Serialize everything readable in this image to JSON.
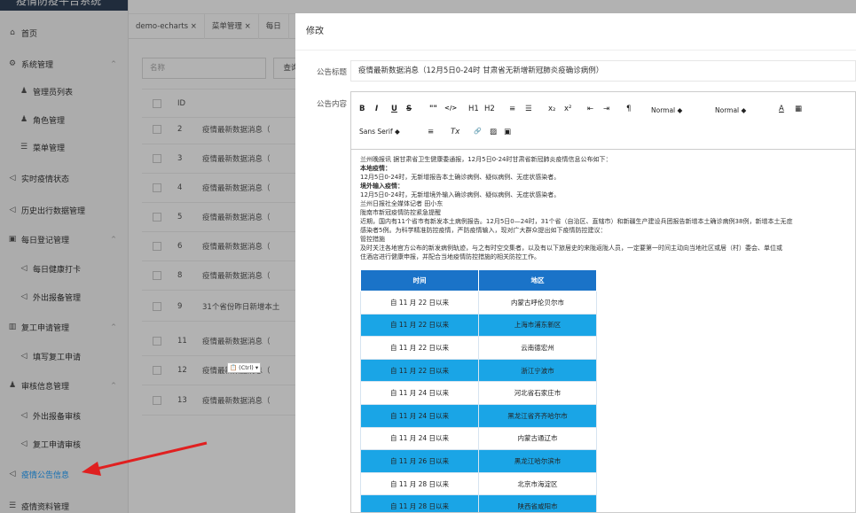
{
  "sidebar": {
    "brand": "疫情防疫平台系统",
    "items": [
      {
        "label": "首页",
        "icon": "home-icon",
        "glyph": "⌂",
        "level": 1
      },
      {
        "label": "系统管理",
        "icon": "gear-icon",
        "glyph": "⚙",
        "level": 1,
        "expand": true
      },
      {
        "label": "管理员列表",
        "icon": "user-icon",
        "glyph": "♟",
        "level": 2
      },
      {
        "label": "角色管理",
        "icon": "user-icon",
        "glyph": "♟",
        "level": 2
      },
      {
        "label": "菜单管理",
        "icon": "list-icon",
        "glyph": "☰",
        "level": 2
      },
      {
        "label": "实时疫情状态",
        "icon": "send-icon",
        "glyph": "◁",
        "level": 1
      },
      {
        "label": "历史出行数据管理",
        "icon": "send-icon",
        "glyph": "◁",
        "level": 1
      },
      {
        "label": "每日登记管理",
        "icon": "form-icon",
        "glyph": "▣",
        "level": 1,
        "expand": true
      },
      {
        "label": "每日健康打卡",
        "icon": "send-icon",
        "glyph": "◁",
        "level": 2
      },
      {
        "label": "外出报备管理",
        "icon": "send-icon",
        "glyph": "◁",
        "level": 2
      },
      {
        "label": "复工申请管理",
        "icon": "chart-icon",
        "glyph": "▥",
        "level": 1,
        "expand": true
      },
      {
        "label": "填写复工申请",
        "icon": "send-icon",
        "glyph": "◁",
        "level": 2
      },
      {
        "label": "审核信息管理",
        "icon": "user-icon",
        "glyph": "♟",
        "level": 1,
        "expand": true
      },
      {
        "label": "外出报备审核",
        "icon": "send-icon",
        "glyph": "◁",
        "level": 2
      },
      {
        "label": "复工申请审核",
        "icon": "send-icon",
        "glyph": "◁",
        "level": 2
      },
      {
        "label": "疫情公告信息",
        "icon": "send-icon",
        "glyph": "◁",
        "level": 1,
        "active": true
      },
      {
        "label": "疫情资料管理",
        "icon": "list-icon",
        "glyph": "☰",
        "level": 1
      }
    ]
  },
  "tabs": [
    "demo-echarts ×",
    "菜单管理 ×",
    "每日"
  ],
  "search": {
    "placeholder": "名称",
    "button": "查询"
  },
  "bg_table": {
    "header_id": "ID",
    "rows": [
      {
        "id": "2",
        "title": "疫情最新数据消息（"
      },
      {
        "id": "3",
        "title": "疫情最新数据消息（"
      },
      {
        "id": "4",
        "title": "疫情最新数据消息（"
      },
      {
        "id": "5",
        "title": "疫情最新数据消息（"
      },
      {
        "id": "6",
        "title": "疫情最新数据消息（"
      },
      {
        "id": "8",
        "title": "疫情最新数据消息（"
      },
      {
        "id": "9",
        "title": "31个省份昨日新增本土"
      },
      {
        "id": "11",
        "title": "疫情最新数据消息（"
      },
      {
        "id": "12",
        "title": "疫情最新数据消息（"
      },
      {
        "id": "13",
        "title": "疫情最新数据消息（"
      }
    ]
  },
  "modal": {
    "title": "修改",
    "label_title": "公告标题",
    "label_content": "公告内容",
    "title_value": "疫情最新数据消息（12月5日0-24时 甘肃省无新增新冠肺炎疫确诊病例）"
  },
  "toolbar": {
    "row1": [
      "B",
      "I",
      "U",
      "S",
      "\"\"",
      "</>",
      "H1",
      "H2",
      "≡",
      "☰",
      "x₂",
      "x²",
      "⇤",
      "⇥",
      "¶",
      "Normal ◆",
      "Normal ◆",
      "A",
      "▦"
    ],
    "font": "Sans Serif ◆",
    "row2": [
      "≡",
      "Tx",
      "🔗",
      "▨",
      "▣"
    ]
  },
  "content": {
    "lines": [
      {
        "text": "兰州晚报讯 据甘肃省卫生健康委通报，12月5日0-24时甘肃省新冠肺炎疫情信息公布如下：",
        "bold": false
      },
      {
        "text": "本地疫情：",
        "bold": true
      },
      {
        "text": "12月5日0-24时，无新增报告本土确诊病例、疑似病例、无症状感染者。",
        "bold": false
      },
      {
        "text": "境外输入疫情：",
        "bold": true
      },
      {
        "text": "12月5日0-24时，无新增境外输入确诊病例、疑似病例、无症状感染者。",
        "bold": false
      },
      {
        "text": "兰州日报社全媒体记者 田小东",
        "bold": false
      },
      {
        "text": "陇南市新冠疫情防控紧急提醒",
        "bold": false
      },
      {
        "text": "近期，国内有11个省市有新发本土病例报告。12月5日0—24时，31个省（自治区、直辖市）和新疆生产建设兵团报告新增本土确诊病例38例，新增本土无症",
        "bold": false
      },
      {
        "text": "感染者5例。为科学精准防控疫情，严防疫情输入，现对广大群众提出如下疫情防控建议：",
        "bold": false
      },
      {
        "text": "管控措施",
        "bold": false
      },
      {
        "text": "及时关注各地官方公布的新发病例轨迹，与之有时空交集者，以及有以下旅居史的来陇返陇人员，一定要第一时间主动向当地社区或居（村）委会、单位或",
        "bold": false
      },
      {
        "text": "住酒店进行健康申报，并配合当地疫情防控措施的相关防控工作。",
        "bold": false
      }
    ]
  },
  "data_table": {
    "headers": [
      "时间",
      "地区"
    ],
    "rows": [
      {
        "time": "自 11 月 22 日以来",
        "area": "内蒙古呼伦贝尔市"
      },
      {
        "time": "自 11 月 22 日以来",
        "area": "上海市浦东新区"
      },
      {
        "time": "自 11 月 22 日以来",
        "area": "云南德宏州"
      },
      {
        "time": "自 11 月 22 日以来",
        "area": "浙江宁波市"
      },
      {
        "time": "自 11 月 24 日以来",
        "area": "河北省石家庄市"
      },
      {
        "time": "自 11 月 24 日以来",
        "area": "黑龙江省齐齐哈尔市"
      },
      {
        "time": "自 11 月 24 日以来",
        "area": "内蒙古通辽市"
      },
      {
        "time": "自 11 月 26 日以来",
        "area": "黑龙江哈尔滨市"
      },
      {
        "time": "自 11 月 28 日以来",
        "area": "北京市海淀区"
      },
      {
        "time": "自 11 月 28 日以来",
        "area": "陕西省咸阳市"
      }
    ]
  },
  "paste_chip": "(Ctrl) ▾",
  "colors": {
    "header_blue": "#1a73c8",
    "row_blue": "#1aa5e6",
    "arrow": "#e02020"
  }
}
